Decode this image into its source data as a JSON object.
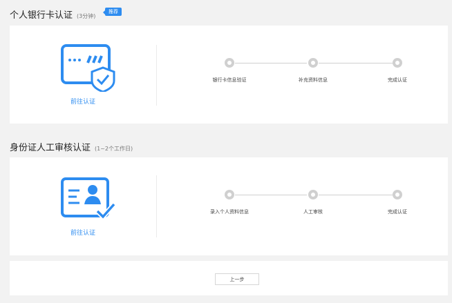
{
  "bank": {
    "title": "个人银行卡认证",
    "duration": "(3分钟)",
    "badge": "推荐",
    "link": "前往认证",
    "steps": [
      "银行卡信息验证",
      "补充资料信息",
      "完成认证"
    ]
  },
  "identity": {
    "title": "身份证人工审核认证",
    "duration": "(1~2个工作日)",
    "link": "前往认证",
    "steps": [
      "录入个人资料信息",
      "人工审核",
      "完成认证"
    ]
  },
  "footer": {
    "prev_label": "上一步"
  },
  "colors": {
    "accent": "#2d8cf0",
    "step_dot": "#d0d0d0"
  }
}
